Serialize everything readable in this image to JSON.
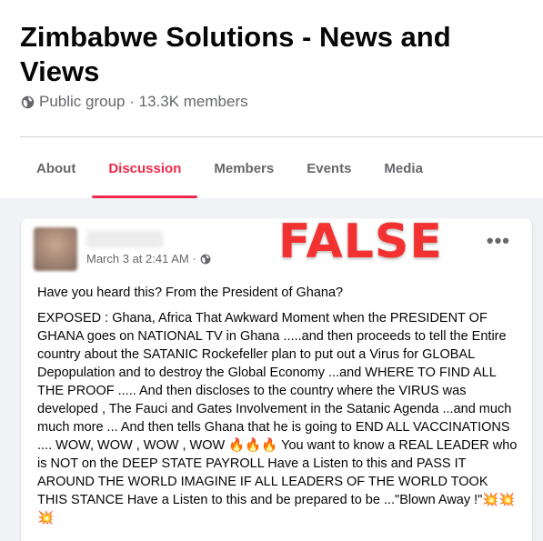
{
  "group": {
    "title": "Zimbabwe Solutions - News and Views",
    "meta": "Public group · 13.3K members",
    "privacy_icon": "globe-icon"
  },
  "tabs": [
    {
      "label": "About",
      "active": false
    },
    {
      "label": "Discussion",
      "active": true
    },
    {
      "label": "Members",
      "active": false
    },
    {
      "label": "Events",
      "active": false
    },
    {
      "label": "Media",
      "active": false
    }
  ],
  "colors": {
    "accent": "#f02849",
    "false_label": "#f43131",
    "muted": "#65676b",
    "background": "#f0f2f5"
  },
  "post": {
    "timestamp": "March 3 at 2:41 AM ·",
    "overlay_label": "FALSE",
    "more_label": "•••",
    "intro": "Have you heard this? From the President of Ghana?",
    "body": "EXPOSED :  Ghana, Africa  That Awkward Moment when the PRESIDENT OF GHANA goes on NATIONAL TV in Ghana  .....and then proceeds to tell the Entire country about the SATANIC Rockefeller plan to put out a Virus  for GLOBAL Depopulation and to destroy the Global Economy ...and WHERE TO FIND ALL THE PROOF .....  And then discloses to the country where the VIRUS was developed , The Fauci and Gates Involvement in the Satanic Agenda ...and much much more ...  And then tells Ghana that he is going to END ALL VACCINATIONS ....  WOW, WOW , WOW , WOW 🔥🔥🔥  You want to know a REAL LEADER who is NOT on the DEEP STATE PAYROLL  Have a Listen to this and PASS IT AROUND THE WORLD  IMAGINE IF ALL LEADERS OF THE WORLD TOOK THIS STANCE  Have a Listen to this and be prepared to be ...\"Blown Away !\"💥💥💥"
  }
}
